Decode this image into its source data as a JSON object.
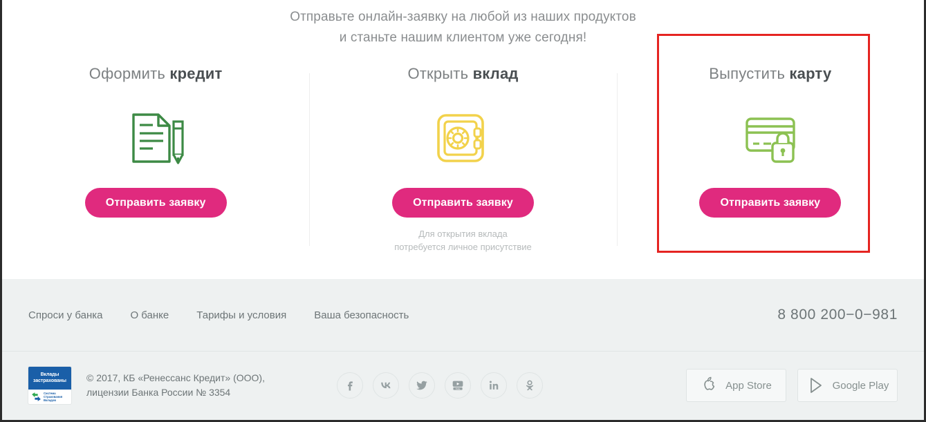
{
  "headline": {
    "line1": "Отправьте онлайн-заявку на любой из наших продуктов",
    "line2": "и станьте нашим клиентом уже сегодня!"
  },
  "cards": [
    {
      "title_regular": "Оформить ",
      "title_bold": "кредит",
      "icon": "document-pen-icon",
      "button_label": "Отправить заявку",
      "note_line1": "",
      "note_line2": ""
    },
    {
      "title_regular": "Открыть ",
      "title_bold": "вклад",
      "icon": "safe-icon",
      "button_label": "Отправить заявку",
      "note_line1": "Для открытия вклада",
      "note_line2": "потребуется личное присутствие"
    },
    {
      "title_regular": "Выпустить ",
      "title_bold": "карту",
      "icon": "credit-card-lock-icon",
      "button_label": "Отправить заявку",
      "note_line1": "",
      "note_line2": ""
    }
  ],
  "annotation": {
    "type": "red-highlight-rectangle",
    "color": "#e52421",
    "targets": "card-issue-card"
  },
  "footer": {
    "links": [
      {
        "label": "Спроси у банка"
      },
      {
        "label": "О банке"
      },
      {
        "label": "Тарифы и условия"
      },
      {
        "label": "Ваша безопасность"
      }
    ],
    "phone": "8 800 200−0−981",
    "insurance_badge": {
      "line1": "Вклады",
      "line2": "застрахованы",
      "sub1": "Система",
      "sub2": "Страхования",
      "sub3": "Вкладов"
    },
    "copyright_line1": "© 2017, КБ «Ренессанс Кредит» (ООО),",
    "copyright_line2": "лицензии Банка России № 3354",
    "socials": [
      {
        "name": "facebook-icon"
      },
      {
        "name": "vk-icon"
      },
      {
        "name": "twitter-icon"
      },
      {
        "name": "youtube-icon"
      },
      {
        "name": "linkedin-icon"
      },
      {
        "name": "odnoklassniki-icon"
      }
    ],
    "stores": [
      {
        "label": "App Store",
        "icon": "apple-icon"
      },
      {
        "label": "Google Play",
        "icon": "google-play-icon"
      }
    ]
  },
  "colors": {
    "accent_pink": "#e02a7e",
    "icon_green": "#3d8a45",
    "icon_yellow": "#f2d24b",
    "icon_light_green": "#8cc152",
    "annotation_red": "#e52421",
    "footer_bg": "#eef1f1"
  }
}
